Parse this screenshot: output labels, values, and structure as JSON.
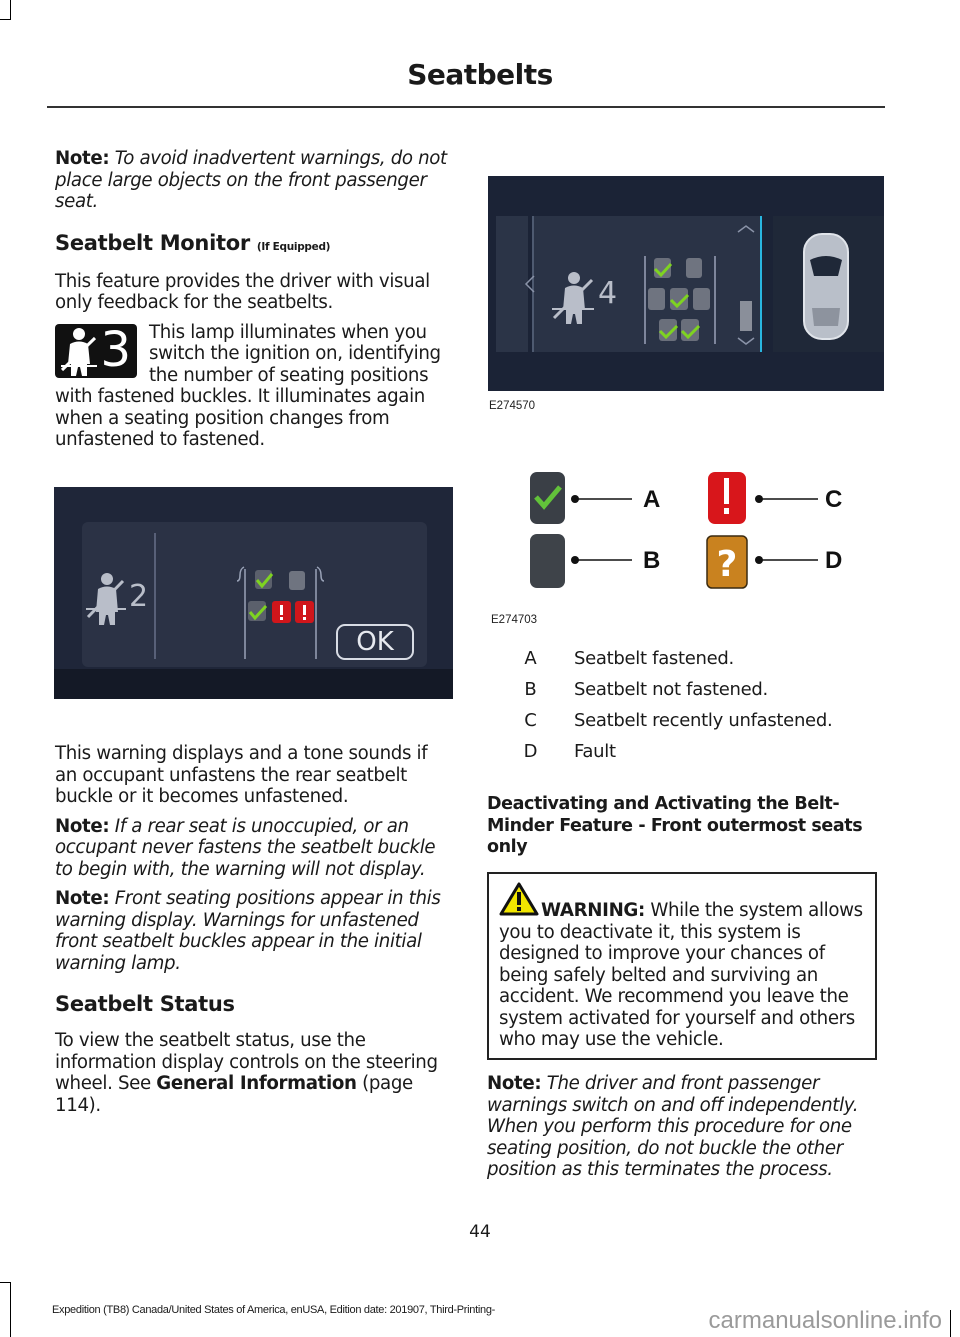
{
  "header": {
    "title": "Seatbelts"
  },
  "left_column": {
    "note1": {
      "label": "Note:",
      "text": "To avoid inadvertent warnings, do not place large objects on the front passenger seat."
    },
    "section1": {
      "title": "Seatbelt Monitor",
      "suffix": "(If Equipped)"
    },
    "para1": "This feature provides the driver with visual only feedback for the seatbelts.",
    "lamp": {
      "icon": "seatbelt-person-icon",
      "count": "3",
      "text": "This lamp illuminates when you switch the ignition on, identifying the number of seating positions with fastened buckles. It illuminates again when a seating position changes from unfastened to fastened."
    },
    "figure1": {
      "belted_count": "2",
      "ok_label": "OK",
      "seats_row1": [
        "fastened",
        "not-fastened"
      ],
      "seats_row2": [
        "fastened",
        "recently-unfastened",
        "recently-unfastened"
      ]
    },
    "para2": "This warning displays and a tone sounds if an occupant unfastens the rear seatbelt buckle or it becomes unfastened.",
    "note2": {
      "label": "Note:",
      "text": "If a rear seat is unoccupied, or an occupant never fastens the seatbelt buckle to begin with, the warning will not display."
    },
    "note3": {
      "label": "Note:",
      "text": "Front seating positions appear in this warning display. Warnings for unfastened front seatbelt buckles appear in the initial warning lamp."
    },
    "section2": {
      "title": "Seatbelt Status"
    },
    "para3": {
      "text": "To view the seatbelt status, use the information display controls on the steering wheel. See ",
      "link": "General Information",
      "suffix": " (page 114)."
    }
  },
  "right_column": {
    "figure2": {
      "id": "E274570",
      "belted_count": "4",
      "seats_row1": [
        "fastened",
        "not-fastened"
      ],
      "seats_row2": [
        "not-fastened",
        "fastened",
        "not-fastened"
      ],
      "seats_row3": [
        "fastened",
        "fastened"
      ]
    },
    "figure3": {
      "id": "E274703",
      "callouts": [
        "A",
        "B",
        "C",
        "D"
      ]
    },
    "legend": [
      {
        "key": "A",
        "desc": "Seatbelt fastened."
      },
      {
        "key": "B",
        "desc": "Seatbelt not fastened."
      },
      {
        "key": "C",
        "desc": "Seatbelt recently unfastened."
      },
      {
        "key": "D",
        "desc": "Fault"
      }
    ],
    "section3": {
      "title": "Deactivating and Activating the Belt-Minder Feature - Front outermost seats only"
    },
    "warning": {
      "label": "WARNING:",
      "text": "While the system allows you to deactivate it, this system is designed to improve your chances of being safely belted and surviving an accident. We recommend you leave the system activated for yourself and others who may use the vehicle."
    },
    "note4": {
      "label": "Note:",
      "text": "The driver and front passenger warnings switch on and off independently. When you perform this procedure for one seating position, do not buckle the other position as this terminates the process."
    }
  },
  "footer": {
    "page_number": "44",
    "edition": "Expedition (TB8) Canada/United States of America, enUSA, Edition date: 201907, Third-Printing-",
    "watermark": "carmanualsonline.info"
  },
  "colors": {
    "screen_bg": "#1b2336",
    "fastened": "#7ed321",
    "unfastened": "#d0161b",
    "fault": "#c9821f"
  }
}
